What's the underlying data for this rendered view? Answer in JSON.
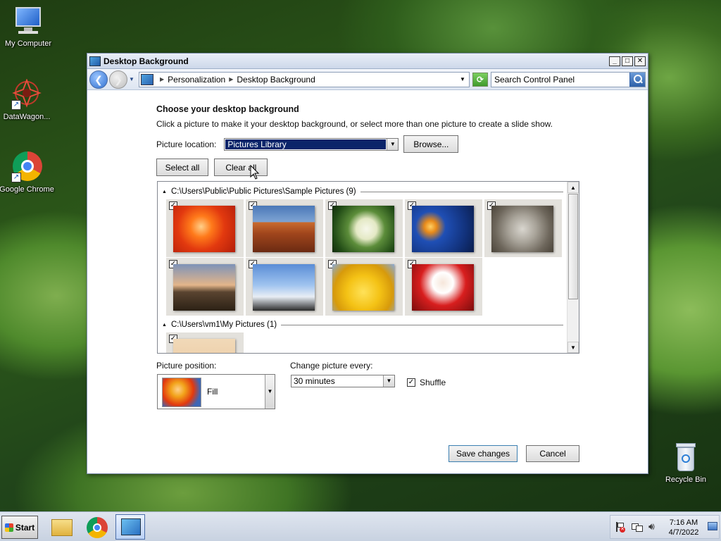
{
  "desktop": {
    "icons": [
      {
        "label": "My Computer",
        "icon": "computer-icon"
      },
      {
        "label": "DataWagon...",
        "icon": "datawagon-icon"
      },
      {
        "label": "Google Chrome",
        "icon": "chrome-icon"
      },
      {
        "label": "Recycle Bin",
        "icon": "recycle-bin-icon"
      }
    ]
  },
  "window": {
    "title": "Desktop Background",
    "controls": {
      "minimize": "_",
      "maximize": "□",
      "close": "✕"
    },
    "address": {
      "crumbs": [
        "Personalization",
        "Desktop Background"
      ],
      "search_placeholder": "Search Control Panel"
    }
  },
  "page": {
    "heading": "Choose your desktop background",
    "subtext": "Click a picture to make it your desktop background, or select more than one picture to create a slide show.",
    "picture_location_label": "Picture location:",
    "picture_location_value": "Pictures Library",
    "browse_label": "Browse...",
    "select_all_label": "Select all",
    "clear_all_label": "Clear all",
    "groups": [
      {
        "title": "C:\\Users\\Public\\Public Pictures\\Sample Pictures (9)",
        "items": [
          {
            "name": "chrysanthemum",
            "checked": true
          },
          {
            "name": "desert",
            "checked": true
          },
          {
            "name": "hydrangeas",
            "checked": true
          },
          {
            "name": "jellyfish",
            "checked": true
          },
          {
            "name": "koala",
            "checked": true
          },
          {
            "name": "lighthouse",
            "checked": true
          },
          {
            "name": "penguins",
            "checked": true
          },
          {
            "name": "tulips",
            "checked": true
          },
          {
            "name": "santa",
            "checked": true
          }
        ]
      },
      {
        "title": "C:\\Users\\vm1\\My Pictures (1)",
        "items": [
          {
            "name": "my-picture",
            "checked": true
          }
        ]
      }
    ],
    "picture_position_label": "Picture position:",
    "picture_position_value": "Fill",
    "change_every_label": "Change picture every:",
    "change_every_value": "30 minutes",
    "shuffle_label": "Shuffle",
    "shuffle_checked": true,
    "save_label": "Save changes",
    "cancel_label": "Cancel"
  },
  "taskbar": {
    "start_label": "Start",
    "apps": [
      "file-explorer-icon",
      "chrome-icon",
      "control-panel-icon"
    ],
    "clock_time": "7:16 AM",
    "clock_date": "4/7/2022"
  }
}
